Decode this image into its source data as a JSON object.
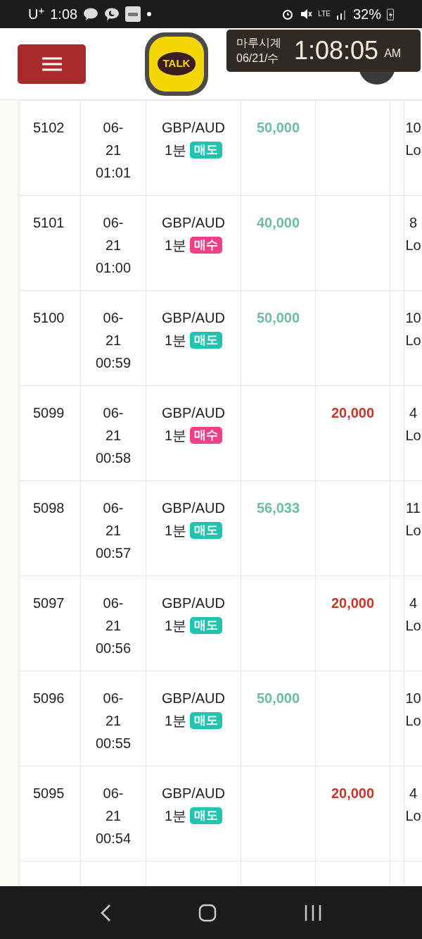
{
  "status_bar": {
    "carrier": "U$^{+}$",
    "time": "1:08",
    "network": "LTE",
    "battery": "32%"
  },
  "header": {
    "logo_text": "TALK",
    "clock_widget": {
      "title": "마루시계",
      "date": "06/21/수",
      "time": "1:08:05",
      "ampm": "AM"
    }
  },
  "table": {
    "rows": [
      {
        "id": "5102",
        "date": [
          "06-",
          "21",
          "01:01"
        ],
        "pair": "GBP/AUD",
        "period": "1분",
        "side": {
          "kind": "sell",
          "label": "매도"
        },
        "profit": "50,000",
        "loss": "",
        "column_7": [
          "10",
          "Lo"
        ]
      },
      {
        "id": "5101",
        "date": [
          "06-",
          "21",
          "01:00"
        ],
        "pair": "GBP/AUD",
        "period": "1분",
        "side": {
          "kind": "buy",
          "label": "매수"
        },
        "profit": "40,000",
        "loss": "",
        "column_7": [
          "8",
          "Lo"
        ]
      },
      {
        "id": "5100",
        "date": [
          "06-",
          "21",
          "00:59"
        ],
        "pair": "GBP/AUD",
        "period": "1분",
        "side": {
          "kind": "sell",
          "label": "매도"
        },
        "profit": "50,000",
        "loss": "",
        "column_7": [
          "10",
          "Lo"
        ]
      },
      {
        "id": "5099",
        "date": [
          "06-",
          "21",
          "00:58"
        ],
        "pair": "GBP/AUD",
        "period": "1분",
        "side": {
          "kind": "buy",
          "label": "매수"
        },
        "profit": "",
        "loss": "20,000",
        "column_7": [
          "4",
          "Lo"
        ]
      },
      {
        "id": "5098",
        "date": [
          "06-",
          "21",
          "00:57"
        ],
        "pair": "GBP/AUD",
        "period": "1분",
        "side": {
          "kind": "sell",
          "label": "매도"
        },
        "profit": "56,033",
        "loss": "",
        "column_7": [
          "11",
          "Lo"
        ]
      },
      {
        "id": "5097",
        "date": [
          "06-",
          "21",
          "00:56"
        ],
        "pair": "GBP/AUD",
        "period": "1분",
        "side": {
          "kind": "sell",
          "label": "매도"
        },
        "profit": "",
        "loss": "20,000",
        "column_7": [
          "4",
          "Lo"
        ]
      },
      {
        "id": "5096",
        "date": [
          "06-",
          "21",
          "00:55"
        ],
        "pair": "GBP/AUD",
        "period": "1분",
        "side": {
          "kind": "sell",
          "label": "매도"
        },
        "profit": "50,000",
        "loss": "",
        "column_7": [
          "10",
          "Lo"
        ]
      },
      {
        "id": "5095",
        "date": [
          "06-",
          "21",
          "00:54"
        ],
        "pair": "GBP/AUD",
        "period": "1분",
        "side": {
          "kind": "sell",
          "label": "매도"
        },
        "profit": "",
        "loss": "20,000",
        "column_7": [
          "4",
          "Lo"
        ]
      }
    ]
  }
}
